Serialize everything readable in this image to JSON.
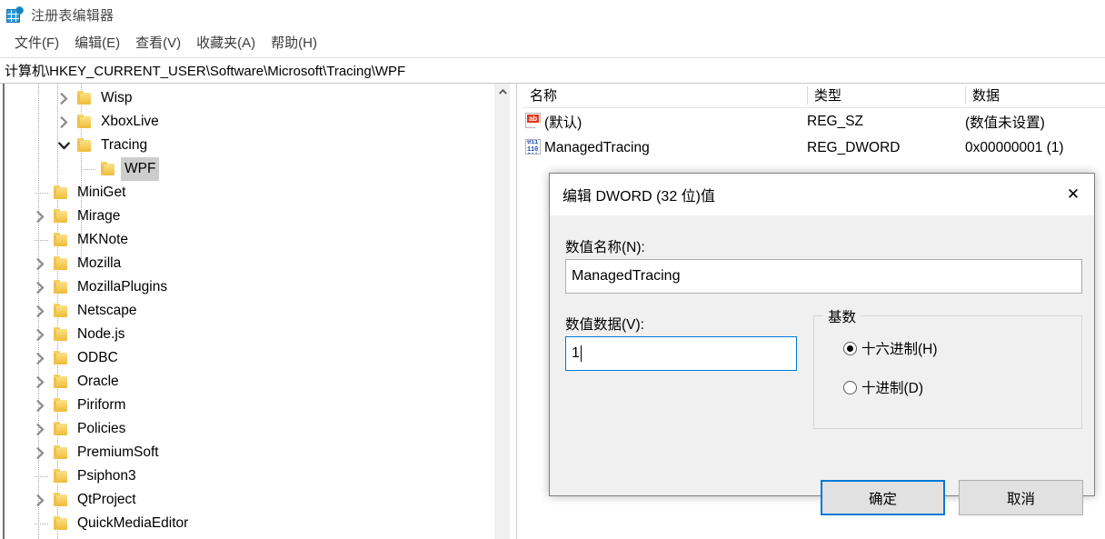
{
  "window": {
    "title": "注册表编辑器",
    "icon": "registry-editor-icon"
  },
  "menubar": {
    "items": [
      {
        "label": "文件(F)"
      },
      {
        "label": "编辑(E)"
      },
      {
        "label": "查看(V)"
      },
      {
        "label": "收藏夹(A)"
      },
      {
        "label": "帮助(H)"
      }
    ]
  },
  "address": {
    "value": "计算机\\HKEY_CURRENT_USER\\Software\\Microsoft\\Tracing\\WPF"
  },
  "tree": {
    "items": [
      {
        "label": "Wisp",
        "depth": 3,
        "twisty": "collapsed",
        "selected": false
      },
      {
        "label": "XboxLive",
        "depth": 3,
        "twisty": "collapsed",
        "selected": false
      },
      {
        "label": "Tracing",
        "depth": 3,
        "twisty": "expanded",
        "selected": false
      },
      {
        "label": "WPF",
        "depth": 4,
        "twisty": "leaf",
        "selected": true
      },
      {
        "label": "MiniGet",
        "depth": 2,
        "twisty": "leaf",
        "selected": false
      },
      {
        "label": "Mirage",
        "depth": 2,
        "twisty": "collapsed",
        "selected": false
      },
      {
        "label": "MKNote",
        "depth": 2,
        "twisty": "leaf",
        "selected": false
      },
      {
        "label": "Mozilla",
        "depth": 2,
        "twisty": "collapsed",
        "selected": false
      },
      {
        "label": "MozillaPlugins",
        "depth": 2,
        "twisty": "collapsed",
        "selected": false
      },
      {
        "label": "Netscape",
        "depth": 2,
        "twisty": "collapsed",
        "selected": false
      },
      {
        "label": "Node.js",
        "depth": 2,
        "twisty": "collapsed",
        "selected": false
      },
      {
        "label": "ODBC",
        "depth": 2,
        "twisty": "collapsed",
        "selected": false
      },
      {
        "label": "Oracle",
        "depth": 2,
        "twisty": "collapsed",
        "selected": false
      },
      {
        "label": "Piriform",
        "depth": 2,
        "twisty": "collapsed",
        "selected": false
      },
      {
        "label": "Policies",
        "depth": 2,
        "twisty": "collapsed",
        "selected": false
      },
      {
        "label": "PremiumSoft",
        "depth": 2,
        "twisty": "collapsed",
        "selected": false
      },
      {
        "label": "Psiphon3",
        "depth": 2,
        "twisty": "leaf",
        "selected": false
      },
      {
        "label": "QtProject",
        "depth": 2,
        "twisty": "collapsed",
        "selected": false
      },
      {
        "label": "QuickMediaEditor",
        "depth": 2,
        "twisty": "leaf",
        "selected": false
      }
    ],
    "scroll_up_glyph": "︿"
  },
  "list": {
    "columns": [
      {
        "label": "名称"
      },
      {
        "label": "类型"
      },
      {
        "label": "数据"
      }
    ],
    "rows": [
      {
        "icon": "string-value-icon",
        "name": "(默认)",
        "type": "REG_SZ",
        "data": "(数值未设置)"
      },
      {
        "icon": "dword-value-icon",
        "name": "ManagedTracing",
        "type": "REG_DWORD",
        "data": "0x00000001 (1)"
      }
    ]
  },
  "dialog": {
    "title": "编辑 DWORD (32 位)值",
    "close_glyph": "✕",
    "value_name_label": "数值名称(N):",
    "value_name": "ManagedTracing",
    "value_data_label": "数值数据(V):",
    "value_data": "1",
    "base_group_label": "基数",
    "radios": [
      {
        "label": "十六进制(H)",
        "checked": true
      },
      {
        "label": "十进制(D)",
        "checked": false
      }
    ],
    "ok_label": "确定",
    "cancel_label": "取消"
  },
  "colors": {
    "accent": "#0078d7",
    "selection": "#cdcdcd",
    "folder": "#f6cd5c",
    "dialog_bg": "#f0f0f0"
  }
}
